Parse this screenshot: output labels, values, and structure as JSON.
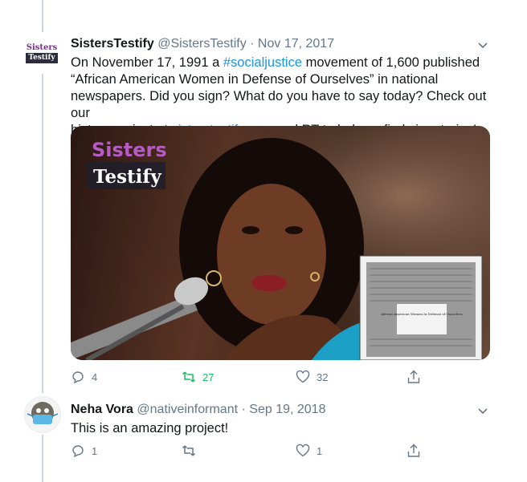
{
  "tweet1": {
    "avatar_text1": "Sisters",
    "avatar_text2": "Testify",
    "name": "SistersTestify",
    "handle": "@SistersTestify",
    "sep": "·",
    "date": "Nov 17, 2017",
    "text_lines": [
      {
        "pre": "On November 17, 1991 a ",
        "hashtag": "#socialjustice",
        "post": " movement of 1,600 published"
      },
      {
        "text": "“African American Women in Defense of Ourselves” in national"
      },
      {
        "text": "newspapers. Did you sign? What do you have to say today? Check out our"
      },
      {
        "pre": "history project at ",
        "link": "sisterstestify.com",
        "post": " and RT to help us find signatories!"
      }
    ],
    "media": {
      "brand_line1": "Sisters",
      "brand_line2": "Testify",
      "newspaper_heading": "African American Women In Defense of Ourselves"
    },
    "replies": "4",
    "retweets": "27",
    "likes": "32"
  },
  "tweet2": {
    "name": "Neha Vora",
    "handle": "@nativeinformant",
    "sep": "·",
    "date": "Sep 19, 2018",
    "text": "This is an amazing project!",
    "replies": "1",
    "likes": "1"
  },
  "colors": {
    "link": "#1b95e0",
    "retweet": "#17bf63",
    "meta": "#657786",
    "brand_purple": "#9b4aa8"
  },
  "icons": [
    "reply-icon",
    "retweet-icon",
    "like-icon",
    "share-icon",
    "chevron-down-icon"
  ]
}
